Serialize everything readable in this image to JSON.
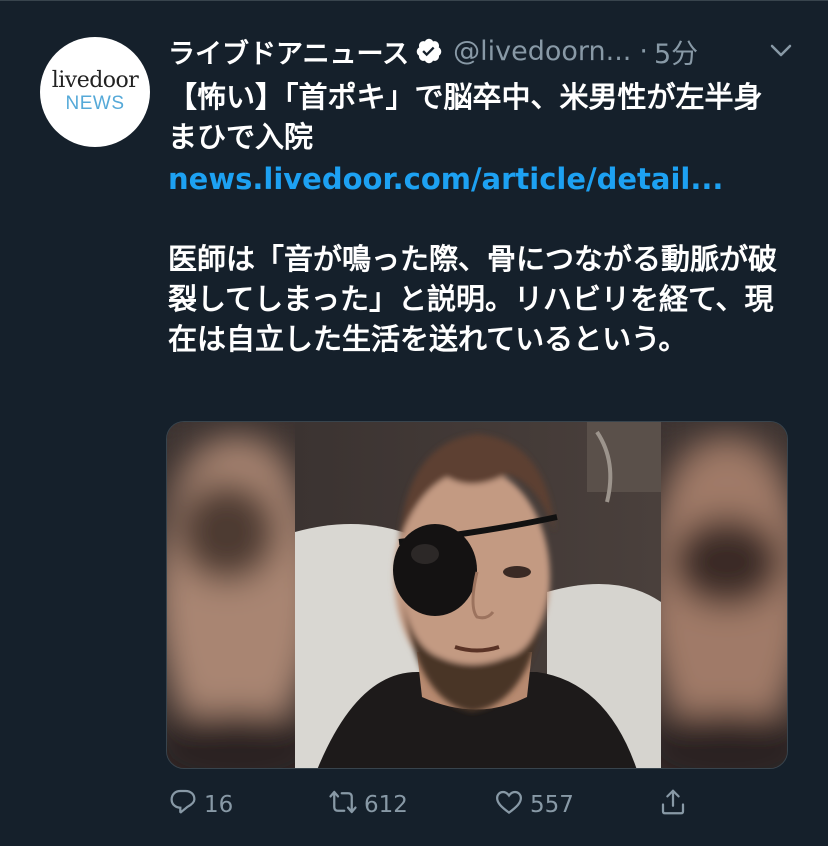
{
  "tweet": {
    "avatar": {
      "brand": "livedoor",
      "sub": "NEWS"
    },
    "author_name": "ライブドアニュース",
    "handle": "@livedoorn...",
    "separator": "·",
    "time": "5分",
    "headline": "【怖い】「首ポキ」で脳卒中、米男性が左半身まひで入院",
    "link": "news.livedoor.com/article/detail...",
    "body": "医師は「音が鳴った際、骨につながる動脈が破裂してしまった」と説明。リハビリを経て、現在は自立した生活を送れているという。"
  },
  "actions": {
    "reply_count": "16",
    "retweet_count": "612",
    "like_count": "557"
  },
  "colors": {
    "background": "#15202b",
    "link": "#1da1f2",
    "muted": "#8899a6"
  },
  "icons": {
    "verified": "verified-badge-icon",
    "caret": "chevron-down-icon",
    "reply": "reply-icon",
    "retweet": "retweet-icon",
    "like": "heart-icon",
    "share": "share-icon"
  }
}
